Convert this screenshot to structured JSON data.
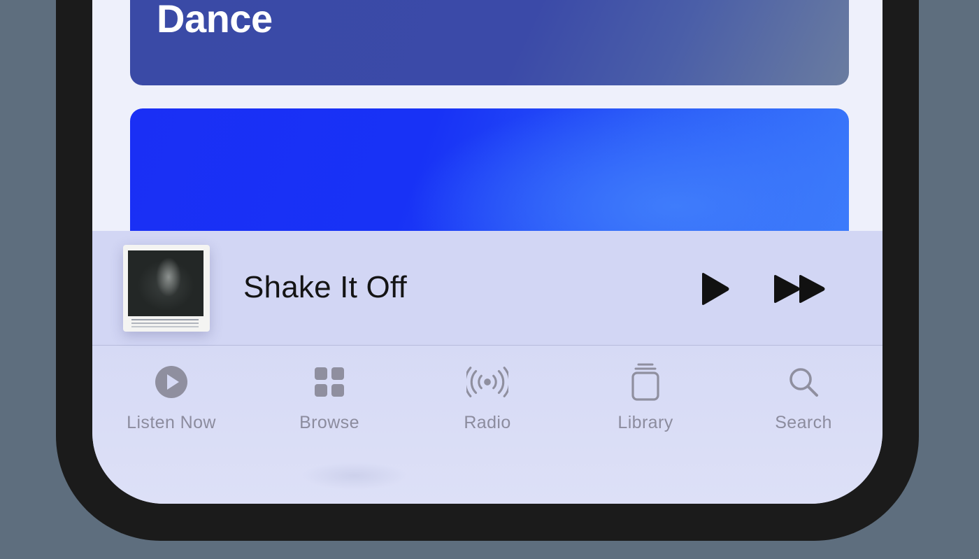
{
  "browse": {
    "cards": [
      {
        "title": "Dance"
      },
      {
        "title": ""
      }
    ]
  },
  "mini_player": {
    "song_title": "Shake It Off",
    "controls": {
      "play_icon": "play-icon",
      "forward_icon": "fast-forward-icon"
    }
  },
  "tab_bar": {
    "tabs": [
      {
        "label": "Listen Now",
        "icon": "play-circle-icon"
      },
      {
        "label": "Browse",
        "icon": "grid-icon"
      },
      {
        "label": "Radio",
        "icon": "broadcast-icon"
      },
      {
        "label": "Library",
        "icon": "stack-icon"
      },
      {
        "label": "Search",
        "icon": "magnifier-icon"
      }
    ]
  },
  "colors": {
    "tab_inactive": "#8c8c9e",
    "dance_card": "#3a4aa6",
    "blue_card": "#1a2ff5",
    "mini_player_bg": "#d2d6f4"
  }
}
